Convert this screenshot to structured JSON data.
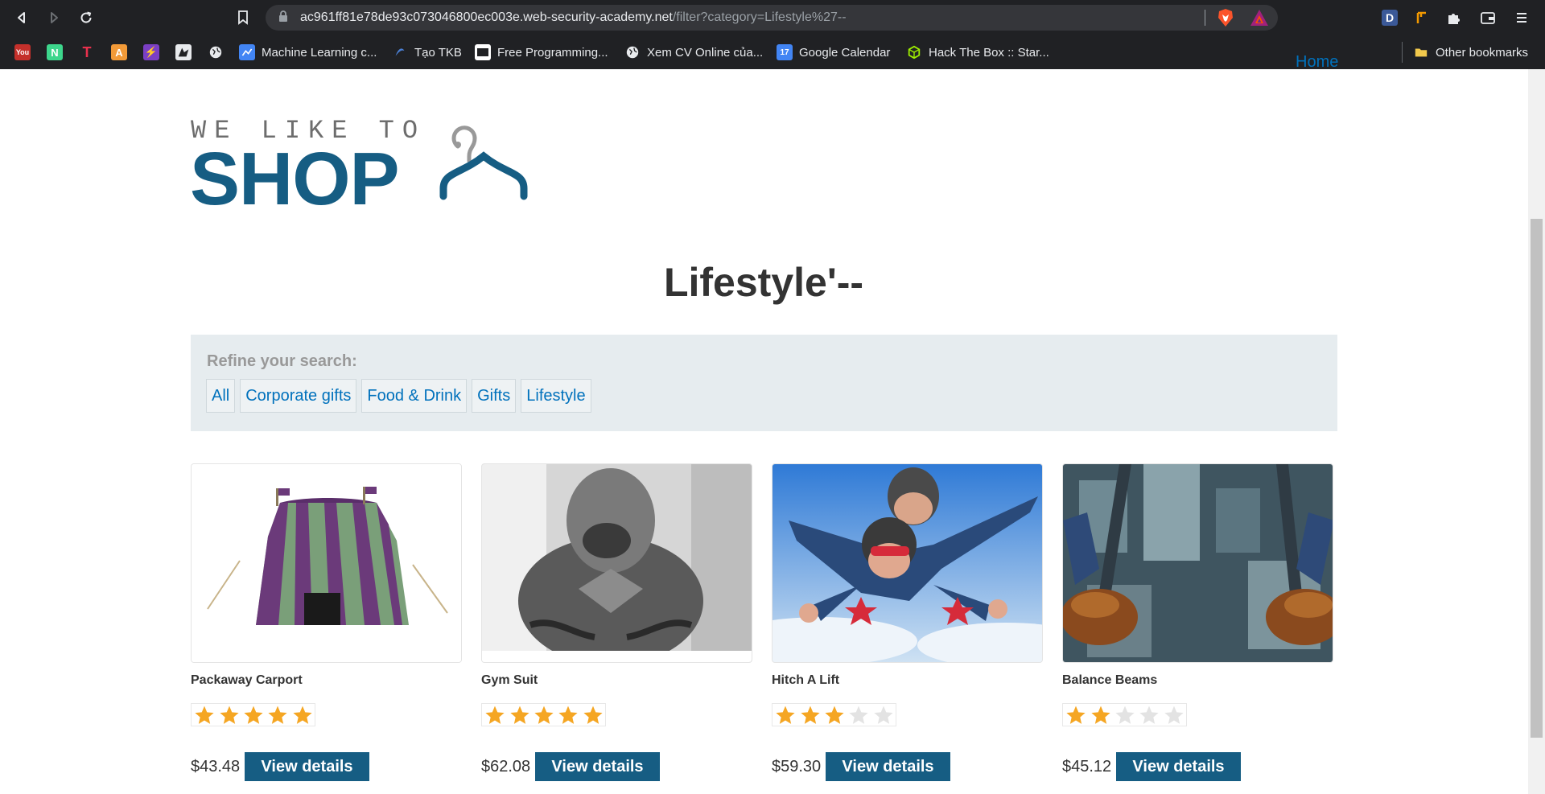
{
  "browser": {
    "url_host": "ac961ff81e78de93c073046800ec003e.web-security-academy.net",
    "url_path": "/filter?category=Lifestyle%27--",
    "bookmarks": [
      {
        "label": "",
        "icon": "youtube-red-icon"
      },
      {
        "label": "",
        "icon": "n-green-icon",
        "glyph": "N"
      },
      {
        "label": "",
        "icon": "t-red-icon",
        "glyph": "T"
      },
      {
        "label": "",
        "icon": "a-orange-icon",
        "glyph": "A"
      },
      {
        "label": "",
        "icon": "bolt-purple-icon",
        "glyph": "⚡"
      },
      {
        "label": "",
        "icon": "wolf-icon"
      },
      {
        "label": "",
        "icon": "globe-icon"
      },
      {
        "label": "Machine Learning c...",
        "icon": "ml-icon"
      },
      {
        "label": "Tạo TKB",
        "icon": "tkb-icon"
      },
      {
        "label": "Free Programming...",
        "icon": "code-icon"
      },
      {
        "label": "Xem CV Online của...",
        "icon": "globe-icon"
      },
      {
        "label": "Google Calendar",
        "icon": "calendar-icon",
        "glyph": "17"
      },
      {
        "label": "Hack The Box :: Star...",
        "icon": "htb-icon"
      }
    ],
    "other_bookmarks": "Other bookmarks"
  },
  "nav": {
    "home": "Home"
  },
  "logo": {
    "top": "WE LIKE TO",
    "main": "SHOP"
  },
  "page": {
    "title": "Lifestyle'--"
  },
  "filter": {
    "heading": "Refine your search:",
    "categories": [
      "All",
      "Corporate gifts",
      "Food & Drink",
      "Gifts",
      "Lifestyle"
    ]
  },
  "products": [
    {
      "name": "Packaway Carport",
      "rating": 5,
      "price": "$43.48",
      "button": "View details"
    },
    {
      "name": "Gym Suit",
      "rating": 5,
      "price": "$62.08",
      "button": "View details"
    },
    {
      "name": "Hitch A Lift",
      "rating": 3,
      "price": "$59.30",
      "button": "View details"
    },
    {
      "name": "Balance Beams",
      "rating": 2,
      "price": "$45.12",
      "button": "View details"
    }
  ],
  "colors": {
    "brand": "#165d83",
    "link": "#0071bc",
    "star_on": "#f5a623",
    "star_off": "#e3e3e3"
  }
}
